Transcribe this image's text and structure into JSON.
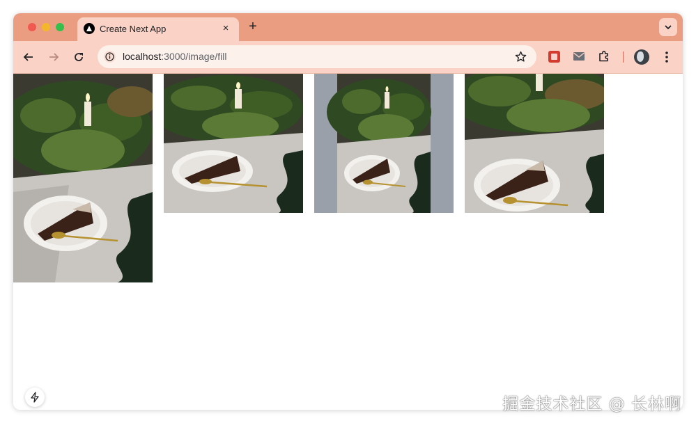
{
  "window": {
    "tab_title": "Create Next App",
    "tab_close": "×",
    "new_tab": "+"
  },
  "omnibox": {
    "host": "localhost",
    "path": ":3000/image/fill"
  },
  "colors": {
    "titlebar": "#eb9d82",
    "toolbar": "#fbd3c6",
    "letterbox": "#9aa0aa"
  },
  "images": [
    {
      "label": "fill-image-portrait"
    },
    {
      "label": "fill-image-cover"
    },
    {
      "label": "fill-image-contain"
    },
    {
      "label": "fill-image-cropped"
    }
  ],
  "watermark": "掘金技术社区 @ 长林啊"
}
